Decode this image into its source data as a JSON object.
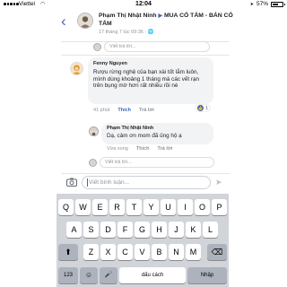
{
  "status_bar": {
    "carrier": "Viettel",
    "time": "12:04",
    "battery_text": "57%",
    "battery_level": 0.57
  },
  "header": {
    "back_icon": "chevron-left-icon",
    "author": "Phạm Thị Nhật Ninh",
    "separator": "▶",
    "group": "MUA CỎ TẤM - BÁN CỎ TẤM",
    "timestamp": "17 tháng 7 lúc 09:36 · ",
    "privacy_icon": "globe-icon"
  },
  "top_reply": {
    "placeholder": "Viết trả lời..."
  },
  "comment": {
    "author": "Fenny Nguyen",
    "text": "Rượu rừng nghệ của bạn xài tốt lắm luôn, mình dùng khoảng 1 tháng mà các vết rạn trên bụng mờ hơn rất nhiều rồi nè",
    "time": "41 phút",
    "like_label": "Thích",
    "reply_label": "Trả lời",
    "reaction_count": "1"
  },
  "reply": {
    "author": "Phạm Thị Nhật Ninh",
    "text": "Dạ, cảm ơn mom đã ủng hộ ạ",
    "time": "Vừa xong",
    "like_label": "Thích",
    "reply_label": "Trả lời"
  },
  "bottom_reply": {
    "placeholder": "Viết trả lời..."
  },
  "composer": {
    "placeholder": "Viết bình luận...",
    "camera_icon": "camera-icon",
    "send_icon": "send-icon"
  },
  "keyboard": {
    "row1": [
      "Q",
      "W",
      "E",
      "R",
      "T",
      "Y",
      "U",
      "I",
      "O",
      "P"
    ],
    "row2": [
      "A",
      "S",
      "D",
      "F",
      "G",
      "H",
      "J",
      "K",
      "L"
    ],
    "row3": [
      "Z",
      "X",
      "C",
      "V",
      "B",
      "N",
      "M"
    ],
    "shift": "⬆",
    "backspace": "⌫",
    "numbers": "123",
    "emoji": "☺",
    "mic": "🎤",
    "space": "dấu cách",
    "return": "Nhập"
  }
}
